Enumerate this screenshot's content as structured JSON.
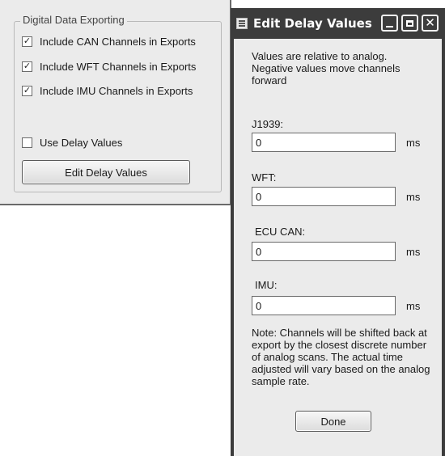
{
  "options_panel": {
    "group_title": "Digital Data Exporting",
    "checkboxes": [
      {
        "label": "Include CAN Channels in Exports",
        "checked": true
      },
      {
        "label": "Include WFT Channels in Exports",
        "checked": true
      },
      {
        "label": "Include IMU Channels in Exports",
        "checked": true
      },
      {
        "label": "Use Delay Values",
        "checked": false
      }
    ],
    "edit_button_label": "Edit Delay Values",
    "check_glyph": "✓"
  },
  "dialog": {
    "title": "Edit Delay Values",
    "description": "Values are relative to analog. Negative values move channels forward",
    "fields": [
      {
        "label": "J1939:",
        "value": "0",
        "unit": "ms"
      },
      {
        "label": "WFT:",
        "value": "0",
        "unit": "ms"
      },
      {
        "label": "ECU CAN:",
        "value": "0",
        "unit": "ms"
      },
      {
        "label": "IMU:",
        "value": "0",
        "unit": "ms"
      }
    ],
    "note": "Note: Channels will be shifted back at export by the closest discrete number of analog scans. The actual time adjusted will vary based on the analog sample rate.",
    "done_label": "Done",
    "window_buttons": {
      "minimize": "minimize-icon",
      "maximize": "maximize-icon",
      "close": "✕"
    }
  }
}
